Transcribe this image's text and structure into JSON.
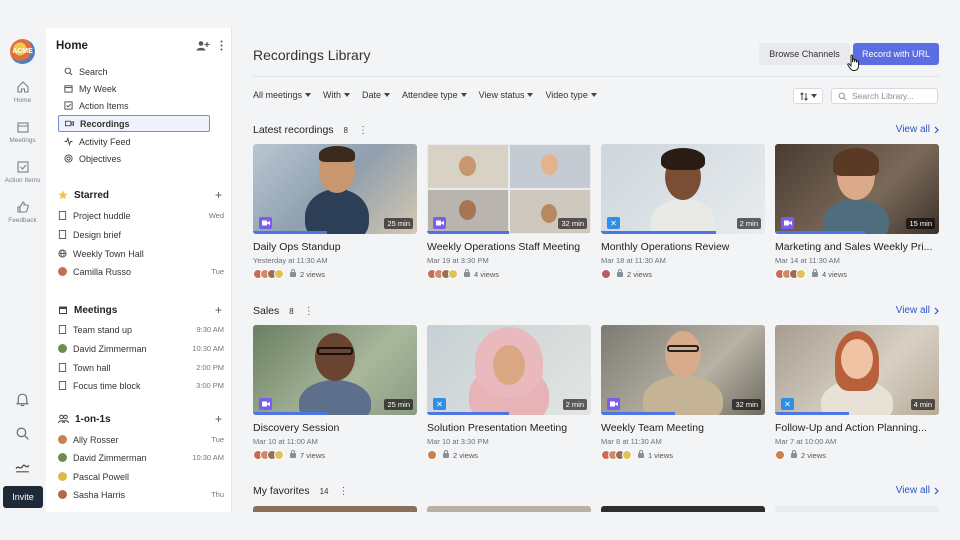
{
  "rail": {
    "logo_text": "ACME",
    "items": [
      {
        "label": "Home",
        "icon": "home-icon"
      },
      {
        "label": "Meetings",
        "icon": "calendar-icon"
      },
      {
        "label": "Action Items",
        "icon": "checkbox-icon"
      },
      {
        "label": "Feedback",
        "icon": "thumbs-up-icon"
      }
    ],
    "bottom_icons": [
      "bell-icon",
      "search-icon",
      "sign-icon"
    ],
    "invite_label": "Invite"
  },
  "left": {
    "title": "Home",
    "nav": [
      {
        "label": "Search",
        "icon": "search-icon"
      },
      {
        "label": "My Week",
        "icon": "calendar-icon"
      },
      {
        "label": "Action Items",
        "icon": "checkbox-icon"
      },
      {
        "label": "Recordings",
        "icon": "video-icon"
      },
      {
        "label": "Activity Feed",
        "icon": "activity-icon"
      },
      {
        "label": "Objectives",
        "icon": "target-icon"
      }
    ],
    "starred": {
      "title": "Starred",
      "items": [
        {
          "label": "Project huddle",
          "meta": "Wed"
        },
        {
          "label": "Design brief",
          "meta": ""
        },
        {
          "label": "Weekly Town Hall",
          "meta": ""
        },
        {
          "label": "Camilla Russo",
          "meta": "Tue"
        }
      ]
    },
    "meetings": {
      "title": "Meetings",
      "items": [
        {
          "label": "Team stand up",
          "meta": "9:30 AM"
        },
        {
          "label": "David Zimmerman",
          "meta": "10:30 AM"
        },
        {
          "label": "Town hall",
          "meta": "2:00 PM"
        },
        {
          "label": "Focus time block",
          "meta": "3:00 PM"
        }
      ]
    },
    "one_on_ones": {
      "title": "1-on-1s",
      "items": [
        {
          "label": "Ally Rosser",
          "meta": "Tue"
        },
        {
          "label": "David Zimmerman",
          "meta": "10:30 AM"
        },
        {
          "label": "Pascal Powell",
          "meta": ""
        },
        {
          "label": "Sasha Harris",
          "meta": "Thu"
        }
      ]
    }
  },
  "main": {
    "title": "Recordings Library",
    "browse_label": "Browse Channels",
    "record_label": "Record with URL",
    "filters": [
      "All meetings",
      "With",
      "Date",
      "Attendee type",
      "View status",
      "Video type"
    ],
    "search_placeholder": "Search Library...",
    "view_all": "View all",
    "sections": [
      {
        "title": "Latest recordings",
        "count": "8",
        "cards": [
          {
            "title": "Daily Ops Standup",
            "date": "Yesterday at 11:30 AM",
            "duration": "25 min",
            "views": "2 views",
            "progress": 0.45
          },
          {
            "title": "Weekly Operations Staff Meeting",
            "date": "Mar 19 at 3:30 PM",
            "duration": "32 min",
            "views": "4 views",
            "progress": 0.5
          },
          {
            "title": "Monthly Operations Review",
            "date": "Mar 18 at 11:30 AM",
            "duration": "2 min",
            "views": "2 views",
            "progress": 0.7
          },
          {
            "title": "Marketing and Sales Weekly Pri...",
            "date": "Mar 14 at 11:30 AM",
            "duration": "15 min",
            "views": "4 views",
            "progress": 0.55
          }
        ]
      },
      {
        "title": "Sales",
        "count": "8",
        "cards": [
          {
            "title": "Discovery Session",
            "date": "Mar 10 at 11:00 AM",
            "duration": "25 min",
            "views": "7 views",
            "progress": 0.45
          },
          {
            "title": "Solution Presentation Meeting",
            "date": "Mar 10 at 3:30 PM",
            "duration": "2 min",
            "views": "2 views",
            "progress": 0.5
          },
          {
            "title": "Weekly Team Meeting",
            "date": "Mar 8 at 11:30 AM",
            "duration": "32 min",
            "views": "1 views",
            "progress": 0.45
          },
          {
            "title": "Follow-Up and Action Planning...",
            "date": "Mar 7 at 10:00 AM",
            "duration": "4 min",
            "views": "2 views",
            "progress": 0.45
          }
        ]
      },
      {
        "title": "My favorites",
        "count": "14"
      }
    ]
  }
}
